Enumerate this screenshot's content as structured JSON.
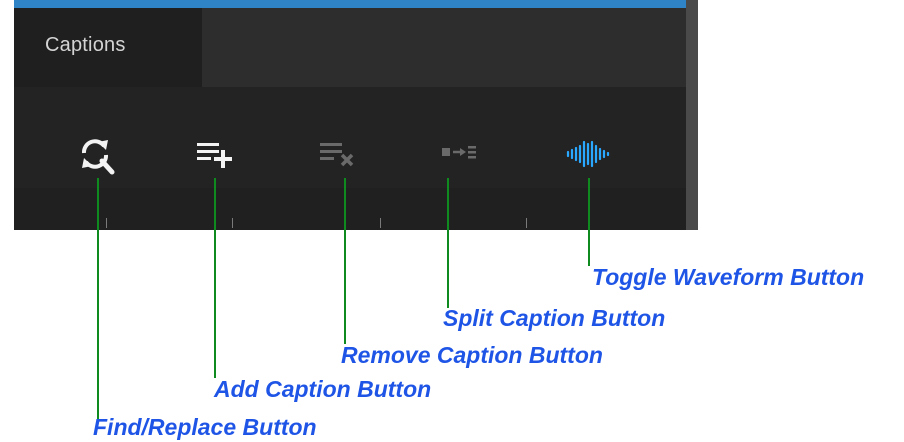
{
  "panel": {
    "tab_label": "Captions"
  },
  "toolbar": {
    "buttons": [
      {
        "id": "find-replace",
        "icon": "find-replace-icon",
        "label": "Find/Replace Button",
        "enabled": true
      },
      {
        "id": "add-caption",
        "icon": "add-caption-icon",
        "label": "Add Caption Button",
        "enabled": true
      },
      {
        "id": "remove-caption",
        "icon": "remove-caption-icon",
        "label": "Remove Caption Button",
        "enabled": false
      },
      {
        "id": "split-caption",
        "icon": "split-caption-icon",
        "label": "Split Caption Button",
        "enabled": false
      },
      {
        "id": "toggle-waveform",
        "icon": "waveform-icon",
        "label": "Toggle Waveform Button",
        "enabled": true
      }
    ]
  },
  "colors": {
    "panel_bg": "#232323",
    "accent": "#2f84c7",
    "icon_active": "#f3f3f3",
    "icon_disabled": "#6a6a6a",
    "waveform": "#2aa7ff",
    "leader_line": "#0f8a1f",
    "annotation_text": "#1f55e6"
  }
}
